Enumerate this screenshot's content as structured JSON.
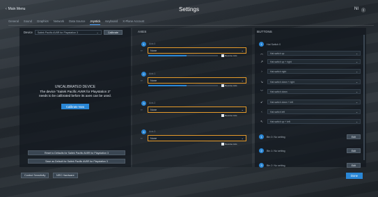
{
  "header": {
    "back_label": "Main Menu",
    "title": "Settings",
    "right_text": "NI"
  },
  "tabs": [
    {
      "label": "General"
    },
    {
      "label": "Sound"
    },
    {
      "label": "Graphics"
    },
    {
      "label": "Network"
    },
    {
      "label": "Data Source"
    },
    {
      "label": "Joystick"
    },
    {
      "label": "Keyboard"
    },
    {
      "label": "X-Plane Account"
    }
  ],
  "device": {
    "label": "Device",
    "selected": "Saitek Pacific AV8R for Playstation 3",
    "calibrate_label": "Calibrate"
  },
  "uncalibrated": {
    "title": "UNCALIBRATED DEVICE",
    "line1": "The device \"Saitek Pacific AV8R for Playstation 3\"",
    "line2": "needs to be calibrated before its axes can be used.",
    "button": "Calibrate Now"
  },
  "reset_buttons": {
    "reset": "Reset to Defaults for Saitek Pacific AV8R for Playstation 3",
    "save": "Save as Default for Saitek Pacific AV8R for Playstation 3"
  },
  "axes": {
    "title": "AXES",
    "reverse_label": "Reverse Axis",
    "items": [
      {
        "num": "1",
        "name": "Axis 0",
        "value": "None",
        "level": 0.55
      },
      {
        "num": "2",
        "name": "Axis 1",
        "value": "None",
        "level": 0.55
      },
      {
        "num": "3",
        "name": "Axis 2",
        "value": "None",
        "level": 0.55
      },
      {
        "num": "4",
        "name": "Axis 3",
        "value": "None",
        "level": 0.55
      }
    ]
  },
  "buttons": {
    "title": "BUTTONS",
    "group1": "Hat Switch 0",
    "rows": [
      {
        "icon": "up",
        "label": "Hat switch up"
      },
      {
        "icon": "up-right",
        "label": "Hat switch up + right"
      },
      {
        "icon": "right",
        "label": "Hat switch right"
      },
      {
        "icon": "down-right",
        "label": "Hat switch down + right"
      },
      {
        "icon": "down",
        "label": "Hat switch down"
      },
      {
        "icon": "down-left",
        "label": "Hat switch down + left"
      },
      {
        "icon": "left",
        "label": "Hat switch left"
      },
      {
        "icon": "up-left",
        "label": "Hat switch up + left"
      }
    ],
    "groups": [
      {
        "num": "1",
        "label": "Btn 0: No setting"
      },
      {
        "num": "2",
        "label": "Btn 1: No setting"
      },
      {
        "num": "3",
        "label": "Btn 2: No setting"
      }
    ],
    "edit_label": "Edit"
  },
  "bottom": {
    "control_sensitivity": "Control Sensitivity",
    "nrc_hardware": "NRC Hardware",
    "done": "Done"
  },
  "colors": {
    "accent": "#2a87d6",
    "highlight": "#e59a2a"
  }
}
